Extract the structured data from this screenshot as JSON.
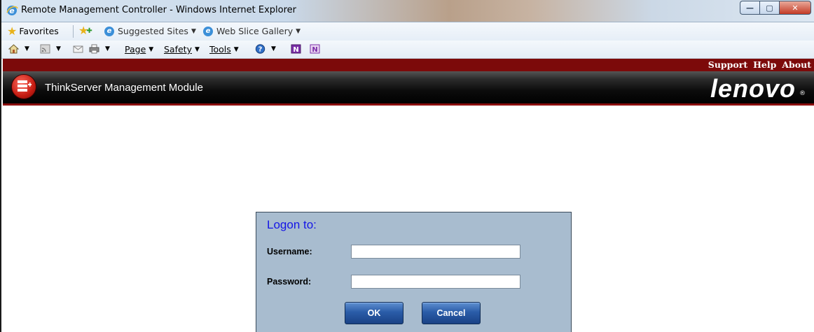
{
  "window": {
    "title": "Remote Management Controller - Windows Internet Explorer",
    "controls": {
      "minimize": "—",
      "maximize": "▢",
      "close": "✕"
    }
  },
  "favorites_bar": {
    "favorites": "Favorites",
    "suggested_sites": "Suggested Sites",
    "web_slice_gallery": "Web Slice Gallery"
  },
  "command_bar": {
    "page": "Page",
    "safety": "Safety",
    "tools": "Tools"
  },
  "header": {
    "top_links": [
      "Support",
      "Help",
      "About"
    ],
    "module_title": "ThinkServer Management Module",
    "brand": "lenovo",
    "brand_mark": "®"
  },
  "login": {
    "heading": "Logon to:",
    "username_label": "Username:",
    "password_label": "Password:",
    "username_value": "",
    "password_value": "",
    "ok_label": "OK",
    "cancel_label": "Cancel"
  },
  "colors": {
    "header_red": "#7c0a0a",
    "login_panel": "#a8bccf",
    "login_heading": "#1515e6",
    "button_blue": "#2a5ca8"
  },
  "icons": [
    "ie-icon",
    "star-icon",
    "add-favorites-icon",
    "home-icon",
    "feeds-icon",
    "mail-icon",
    "print-icon",
    "help-icon",
    "onenote-icon"
  ]
}
